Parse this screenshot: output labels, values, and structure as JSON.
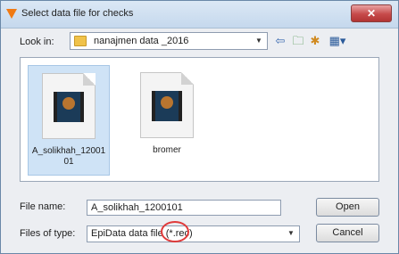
{
  "window": {
    "title": "Select data file for checks",
    "close_glyph": "✕",
    "title_icon": "triangle-down-icon"
  },
  "lookin": {
    "label": "Look in:",
    "value": "nanajmen data _2016",
    "arrow": "▼"
  },
  "toolbar": {
    "back_glyph": "⇦",
    "up_glyph": "🗀",
    "new_folder_glyph": "✱",
    "views_glyph": "▦▾"
  },
  "files": [
    {
      "name": "A_solikhah_1200101",
      "selected": true
    },
    {
      "name": "bromer",
      "selected": false
    }
  ],
  "filename": {
    "label": "File name:",
    "value": "A_solikhah_1200101"
  },
  "filetype": {
    "label": "Files of type:",
    "value": "EpiData data file (*.rec)",
    "arrow": "▼"
  },
  "buttons": {
    "open": "Open",
    "cancel": "Cancel"
  },
  "colors": {
    "accent": "#f07a14",
    "annotation": "#e03a3a",
    "selection": "#cfe3f6"
  }
}
